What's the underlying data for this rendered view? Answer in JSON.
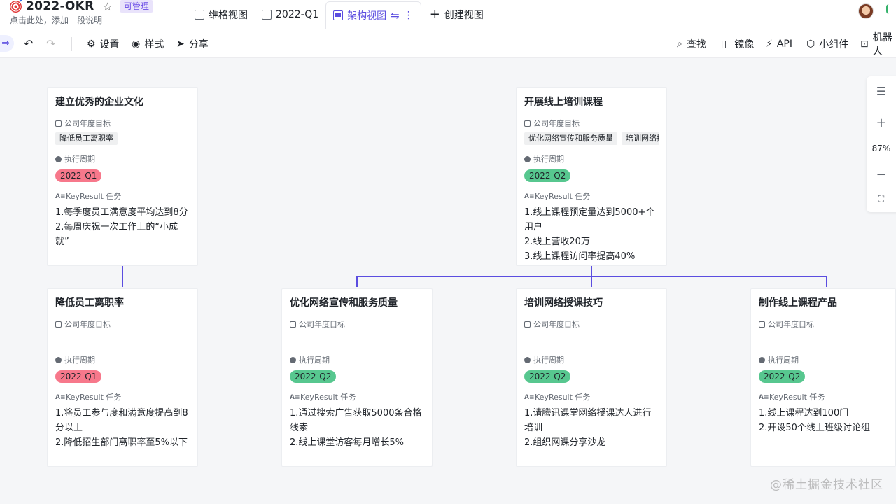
{
  "header": {
    "title": "2022-OKR",
    "permission_badge": "可管理",
    "description": "点击此处，添加一段说明",
    "icons": {
      "app": "target-icon",
      "favorite": "star-icon",
      "avatar": "user-avatar"
    }
  },
  "tabs": [
    {
      "label": "维格视图",
      "icon": "grid-view-icon",
      "active": false
    },
    {
      "label": "2022-Q1",
      "icon": "grid-view-icon",
      "active": false
    },
    {
      "label": "架构视图",
      "icon": "architecture-view-icon",
      "active": true
    },
    {
      "label": "创建视图",
      "icon": "plus-icon",
      "active": false
    }
  ],
  "toolbar": {
    "left": [
      {
        "label": "设置",
        "icon": "gear-icon"
      },
      {
        "label": "样式",
        "icon": "eye-icon"
      },
      {
        "label": "分享",
        "icon": "share-icon"
      }
    ],
    "right": [
      {
        "label": "查找",
        "icon": "search-icon"
      },
      {
        "label": "镜像",
        "icon": "mirror-icon"
      },
      {
        "label": "API",
        "icon": "api-icon"
      },
      {
        "label": "小组件",
        "icon": "widget-icon"
      },
      {
        "label": "机器人",
        "icon": "robot-icon"
      }
    ]
  },
  "fields": {
    "goal": "公司年度目标",
    "period": "执行周期",
    "kr": "KeyResult 任务"
  },
  "cards": [
    {
      "title": "建立优秀的企业文化",
      "goals": [
        "降低员工离职率"
      ],
      "period": "2022-Q1",
      "kr": [
        "1.每季度员工满意度平均达到8分",
        "2.每周庆祝一次工作上的“小成就”"
      ]
    },
    {
      "title": "开展线上培训课程",
      "goals": [
        "优化网络宣传和服务质量",
        "培训网络授课技巧"
      ],
      "period": "2022-Q2",
      "kr": [
        "1.线上课程预定量达到5000+个用户",
        "2.线上营收20万",
        "3.线上课程访问率提高40%"
      ]
    },
    {
      "title": "降低员工离职率",
      "goals": [],
      "period": "2022-Q1",
      "kr": [
        "1.将员工参与度和满意度提高到8分以上",
        "2.降低招生部门离职率至5%以下"
      ]
    },
    {
      "title": "优化网络宣传和服务质量",
      "goals": [],
      "period": "2022-Q2",
      "kr": [
        "1.通过搜索广告获取5000条合格线索",
        "2.线上课堂访客每月增长5%"
      ]
    },
    {
      "title": "培训网络授课技巧",
      "goals": [],
      "period": "2022-Q2",
      "kr": [
        "1.请腾讯课堂网络授课达人进行培训",
        "2.组织网课分享沙龙"
      ]
    },
    {
      "title": "制作线上课程产品",
      "goals": [],
      "period": "2022-Q2",
      "kr": [
        "1.线上课程达到100门",
        "2.开设50个线上班级讨论组"
      ]
    }
  ],
  "empty_value": "—",
  "zoom": {
    "level": "87%"
  },
  "watermark": "@稀土掘金技术社区",
  "colors": {
    "accent": "#5b4de0",
    "q1": "#f7788b",
    "q2": "#57c78f"
  }
}
